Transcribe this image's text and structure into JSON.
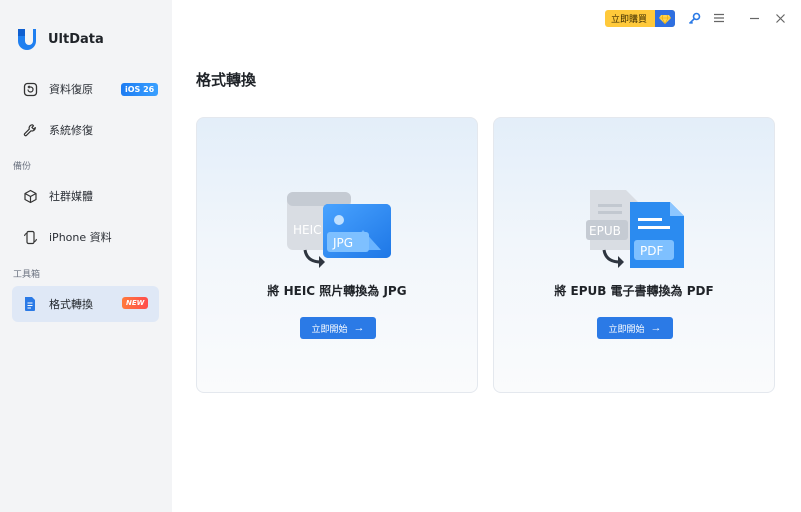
{
  "app": {
    "name": "UltData"
  },
  "sidebar": {
    "items": [
      {
        "label": "資料復原",
        "badge": "iOS 26"
      },
      {
        "label": "系統修復"
      },
      {
        "label": "社群媒體"
      },
      {
        "label": "iPhone 資料"
      },
      {
        "label": "格式轉換",
        "badge": "NEW"
      }
    ],
    "sections": {
      "backup": "備份",
      "toolbox": "工具箱"
    }
  },
  "titlebar": {
    "buy_label": "立即購買"
  },
  "main": {
    "title": "格式轉換",
    "cards": [
      {
        "title": "將 HEIC 照片轉換為 JPG",
        "button": "立即開始",
        "from": "HEIC",
        "to": "JPG"
      },
      {
        "title": "將 EPUB 電子書轉換為 PDF",
        "button": "立即開始",
        "from": "EPUB",
        "to": "PDF"
      }
    ],
    "arrow": "→"
  },
  "colors": {
    "accent": "#2b7ae6",
    "active_bg": "#dfe8f6",
    "buy": "#ffc93a"
  }
}
